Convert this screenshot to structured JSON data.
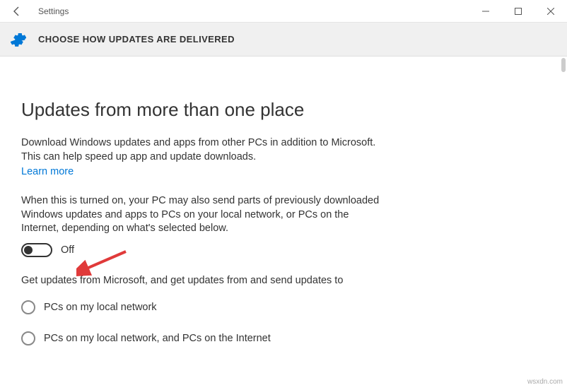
{
  "window": {
    "title": "Settings"
  },
  "header": {
    "heading": "CHOOSE HOW UPDATES ARE DELIVERED"
  },
  "main": {
    "title": "Updates from more than one place",
    "intro": "Download Windows updates and apps from other PCs in addition to Microsoft. This can help speed up app and update downloads.",
    "learn_more": "Learn more",
    "explain": "When this is turned on, your PC may also send parts of previously downloaded Windows updates and apps to PCs on your local network, or PCs on the Internet, depending on what's selected below.",
    "toggle_state": "Off",
    "get_updates_label": "Get updates from Microsoft, and get updates from and send updates to",
    "options": [
      {
        "label": "PCs on my local network"
      },
      {
        "label": "PCs on my local network, and PCs on the Internet"
      }
    ]
  },
  "watermark": "wsxdn.com"
}
